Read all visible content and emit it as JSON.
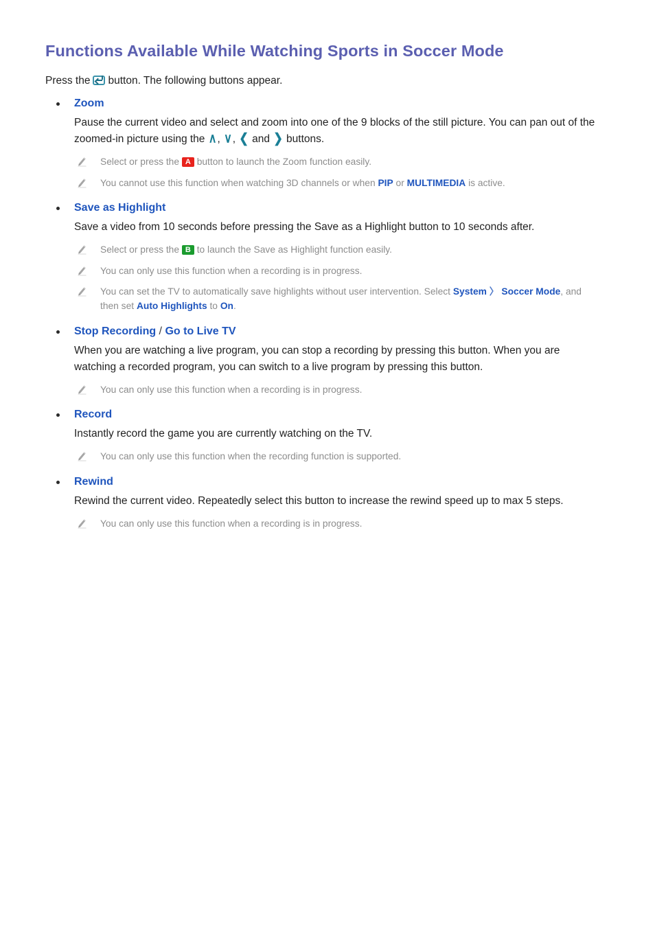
{
  "document": {
    "title": "Functions Available While Watching Sports in Soccer Mode",
    "intro_before": "Press the",
    "intro_icon": "enter-key-icon",
    "intro_after": "button. The following buttons appear."
  },
  "colors": {
    "title": "#5b5fb0",
    "heading_blue": "#1f55bd",
    "teal_arrow": "#1a7f96",
    "note_gray": "#8c8c8c",
    "body": "#222222",
    "key_a_red": "#e8231d",
    "key_b_green": "#1a9b2e"
  },
  "sections": [
    {
      "heading": "Zoom",
      "body": "Pause the current video and select and zoom into one of the 9 blocks of the still picture. You can pan out of the zoomed-in picture using the",
      "body_tail": "buttons.",
      "arrows": [
        "∧",
        "∨",
        "❮",
        "❯"
      ],
      "arrow_sep1": ",",
      "arrow_sep2": ",",
      "arrow_sep3": "and",
      "notes": [
        {
          "parts": [
            {
              "type": "text",
              "value": "Select or press the "
            },
            {
              "type": "badge",
              "value": "A",
              "color": "red"
            },
            {
              "type": "text",
              "value": " button to launch the Zoom function easily."
            }
          ]
        },
        {
          "parts": [
            {
              "type": "text",
              "value": "You cannot use this function when watching 3D channels or when "
            },
            {
              "type": "keyword",
              "value": "PIP"
            },
            {
              "type": "text",
              "value": " or "
            },
            {
              "type": "keyword",
              "value": "MULTIMEDIA"
            },
            {
              "type": "text",
              "value": " is active."
            }
          ]
        }
      ]
    },
    {
      "heading": "Save as Highlight",
      "body": "Save a video from 10 seconds before pressing the Save as a Highlight button to 10 seconds after.",
      "notes": [
        {
          "parts": [
            {
              "type": "text",
              "value": "Select or press the "
            },
            {
              "type": "badge",
              "value": "B",
              "color": "green"
            },
            {
              "type": "text",
              "value": " to launch the Save as Highlight function easily."
            }
          ]
        },
        {
          "parts": [
            {
              "type": "text",
              "value": "You can only use this function when a recording is in progress."
            }
          ]
        },
        {
          "parts": [
            {
              "type": "text",
              "value": "You can set the TV to automatically save highlights without user intervention. Select "
            },
            {
              "type": "keyword",
              "value": "System"
            },
            {
              "type": "gt",
              "value": " 〉 "
            },
            {
              "type": "keyword",
              "value": "Soccer Mode"
            },
            {
              "type": "text",
              "value": ", and then set "
            },
            {
              "type": "keyword",
              "value": "Auto Highlights"
            },
            {
              "type": "text",
              "value": " to "
            },
            {
              "type": "keyword",
              "value": "On"
            },
            {
              "type": "text",
              "value": "."
            }
          ]
        }
      ]
    },
    {
      "heading": "Stop Recording",
      "heading_sep": " / ",
      "heading_alt": "Go to Live TV",
      "body": "When you are watching a live program, you can stop a recording by pressing this button. When you are watching a recorded program, you can switch to a live program by pressing this button.",
      "notes": [
        {
          "parts": [
            {
              "type": "text",
              "value": "You can only use this function when a recording is in progress."
            }
          ]
        }
      ]
    },
    {
      "heading": "Record",
      "body": "Instantly record the game you are currently watching on the TV.",
      "notes": [
        {
          "parts": [
            {
              "type": "text",
              "value": "You can only use this function when the recording function is supported."
            }
          ]
        }
      ]
    },
    {
      "heading": "Rewind",
      "body": "Rewind the current video. Repeatedly select this button to increase the rewind speed up to max 5 steps.",
      "notes": [
        {
          "parts": [
            {
              "type": "text",
              "value": "You can only use this function when a recording is in progress."
            }
          ]
        }
      ]
    }
  ]
}
